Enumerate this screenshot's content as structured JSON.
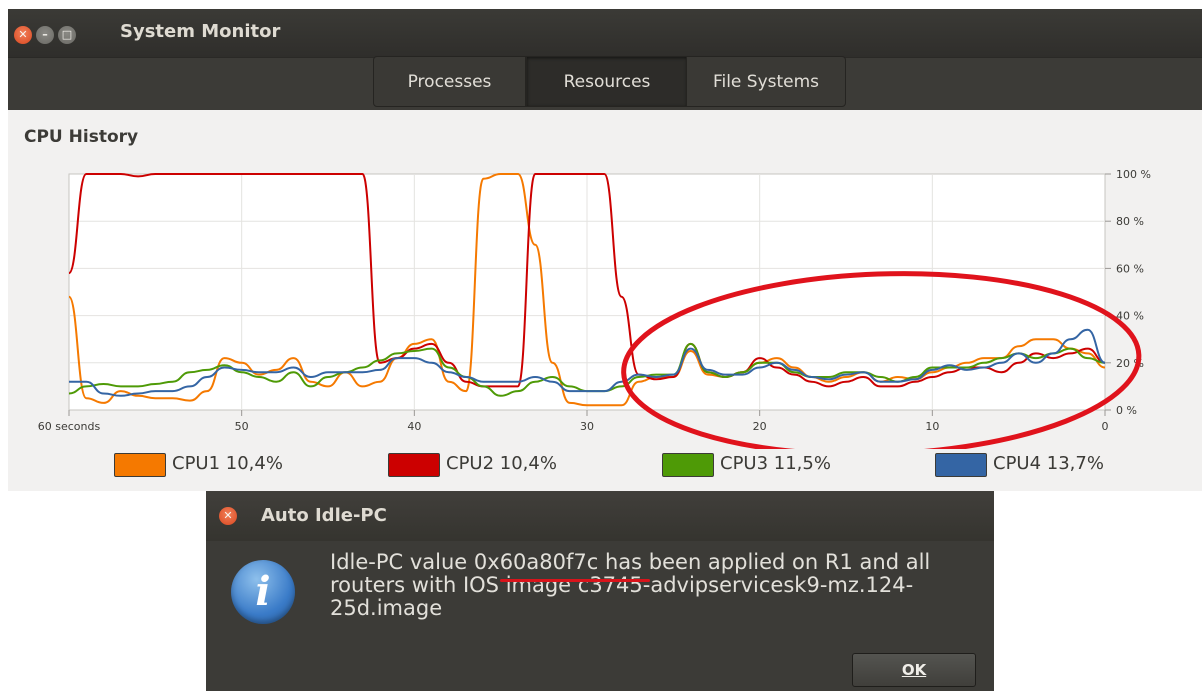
{
  "window": {
    "title": "System Monitor",
    "controls": [
      "close-icon",
      "minimize-icon",
      "maximize-icon"
    ]
  },
  "tabs": [
    {
      "label": "Processes",
      "active": false
    },
    {
      "label": "Resources",
      "active": true
    },
    {
      "label": "File Systems",
      "active": false
    }
  ],
  "section": {
    "title": "CPU History"
  },
  "chart_data": {
    "type": "line",
    "title": "",
    "xlabel": "",
    "ylabel": "",
    "x_range": [
      60,
      0
    ],
    "ylim": [
      0,
      100
    ],
    "x_ticks": [
      {
        "value": 60,
        "label": "60 seconds"
      },
      {
        "value": 50,
        "label": "50"
      },
      {
        "value": 40,
        "label": "40"
      },
      {
        "value": 30,
        "label": "30"
      },
      {
        "value": 20,
        "label": "20"
      },
      {
        "value": 10,
        "label": "10"
      },
      {
        "value": 0,
        "label": "0"
      }
    ],
    "y_ticks": [
      {
        "value": 100,
        "label": "100 %"
      },
      {
        "value": 80,
        "label": "80 %"
      },
      {
        "value": 60,
        "label": "60 %"
      },
      {
        "value": 40,
        "label": "40 %"
      },
      {
        "value": 20,
        "label": "20 %"
      },
      {
        "value": 0,
        "label": "0 %"
      }
    ],
    "grid": true,
    "x": [
      60,
      59,
      58,
      57,
      56,
      55,
      54,
      53,
      52,
      51,
      50,
      49,
      48,
      47,
      46,
      45,
      44,
      43,
      42,
      41,
      40,
      39,
      38,
      37,
      36,
      35,
      34,
      33,
      32,
      31,
      30,
      29,
      28,
      27,
      26,
      25,
      24,
      23,
      22,
      21,
      20,
      19,
      18,
      17,
      16,
      15,
      14,
      13,
      12,
      11,
      10,
      9,
      8,
      7,
      6,
      5,
      4,
      3,
      2,
      1,
      0
    ],
    "series": [
      {
        "name": "CPU1",
        "color": "#f57900",
        "values": [
          48,
          5,
          3,
          8,
          6,
          5,
          5,
          4,
          8,
          22,
          20,
          15,
          17,
          22,
          12,
          10,
          16,
          10,
          12,
          22,
          28,
          30,
          12,
          8,
          98,
          100,
          100,
          70,
          20,
          3,
          2,
          2,
          2,
          12,
          14,
          14,
          25,
          15,
          14,
          16,
          20,
          22,
          18,
          14,
          12,
          14,
          16,
          12,
          14,
          13,
          16,
          18,
          20,
          22,
          22,
          27,
          30,
          30,
          26,
          24,
          18
        ]
      },
      {
        "name": "CPU2",
        "color": "#cc0000",
        "values": [
          58,
          100,
          100,
          100,
          99,
          100,
          100,
          100,
          100,
          100,
          100,
          100,
          100,
          100,
          100,
          100,
          100,
          100,
          20,
          22,
          26,
          28,
          20,
          12,
          10,
          10,
          10,
          100,
          100,
          100,
          100,
          100,
          48,
          15,
          13,
          14,
          28,
          16,
          14,
          16,
          22,
          18,
          15,
          12,
          10,
          12,
          14,
          10,
          10,
          12,
          14,
          16,
          18,
          18,
          16,
          20,
          24,
          22,
          24,
          26,
          20
        ]
      },
      {
        "name": "CPU3",
        "color": "#4e9a06",
        "values": [
          7,
          10,
          11,
          10,
          10,
          11,
          12,
          16,
          17,
          19,
          16,
          14,
          12,
          16,
          10,
          14,
          16,
          18,
          21,
          24,
          25,
          26,
          18,
          14,
          10,
          6,
          8,
          12,
          14,
          10,
          8,
          8,
          10,
          14,
          15,
          15,
          28,
          16,
          14,
          16,
          20,
          20,
          16,
          14,
          14,
          16,
          16,
          14,
          12,
          14,
          18,
          18,
          18,
          20,
          22,
          24,
          22,
          24,
          26,
          22,
          20
        ]
      },
      {
        "name": "CPU4",
        "color": "#3465a4",
        "values": [
          12,
          12,
          7,
          6,
          7,
          8,
          8,
          10,
          14,
          18,
          17,
          16,
          16,
          18,
          14,
          16,
          16,
          16,
          17,
          22,
          22,
          20,
          16,
          14,
          12,
          12,
          12,
          14,
          12,
          8,
          8,
          8,
          12,
          15,
          14,
          15,
          26,
          17,
          15,
          15,
          18,
          20,
          17,
          14,
          13,
          15,
          16,
          12,
          12,
          13,
          17,
          19,
          17,
          18,
          20,
          24,
          20,
          24,
          30,
          34,
          20
        ]
      }
    ],
    "annotation": {
      "shape": "ellipse",
      "color": "#e0131c",
      "target": "right portion of graph (x 28 to 0)"
    }
  },
  "legend": [
    {
      "label": "CPU1 10,4%",
      "color": "#f57900"
    },
    {
      "label": "CPU2 10,4%",
      "color": "#cc0000"
    },
    {
      "label": "CPU3 11,5%",
      "color": "#4e9a06"
    },
    {
      "label": "CPU4 13,7%",
      "color": "#3465a4"
    }
  ],
  "dialog": {
    "title": "Auto Idle-PC",
    "icon": "info-icon",
    "message_before": "Idle-PC value ",
    "value": "0x60a80f7c",
    "message_after": " has been applied on R1 and all routers with IOS image c3745-advipservicesk9-mz.124-25d.image",
    "ok_label": "OK",
    "highlight_color": "#d9141b"
  }
}
